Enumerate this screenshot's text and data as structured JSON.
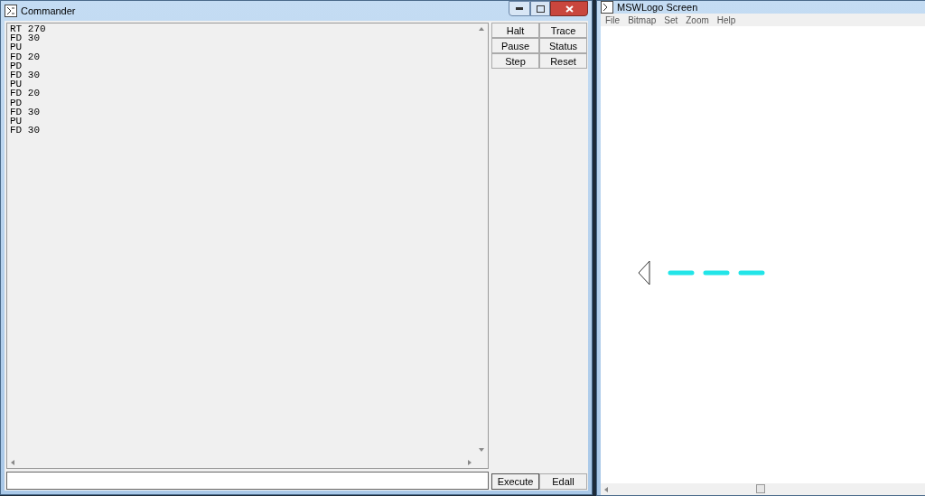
{
  "commander": {
    "title": "Commander",
    "history": [
      "RT 270",
      "FD 30",
      "PU",
      "FD 20",
      "PD",
      "FD 30",
      "PU",
      "FD 20",
      "PD",
      "FD 30",
      "PU",
      "FD 30"
    ],
    "buttons": [
      "Halt",
      "Trace",
      "Pause",
      "Status",
      "Step",
      "Reset"
    ],
    "input_buttons": [
      "Execute",
      "Edall"
    ]
  },
  "screen": {
    "title": "MSWLogo Screen",
    "menu": [
      "File",
      "Bitmap",
      "Set",
      "Zoom",
      "Help"
    ]
  }
}
